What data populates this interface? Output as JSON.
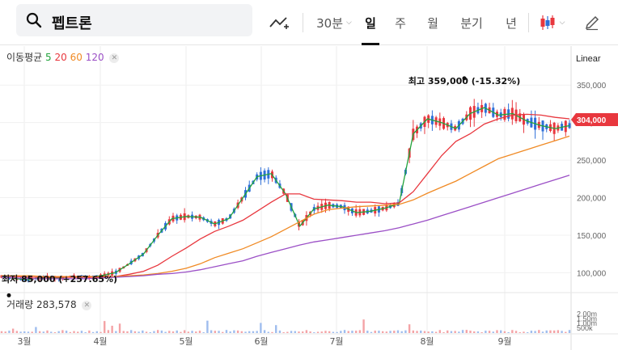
{
  "search": {
    "query": "펩트론"
  },
  "toolbar": {
    "interval": "30분",
    "tabs": [
      "일",
      "주",
      "월",
      "분기",
      "년"
    ],
    "active_tab": "일"
  },
  "indicators": {
    "label": "이동평균",
    "periods": [
      "5",
      "20",
      "60",
      "120"
    ],
    "colors": {
      "ma5": "#22a33b",
      "ma20": "#e8373e",
      "ma60": "#f08a24",
      "ma120": "#9b4fc6"
    }
  },
  "volume_label": {
    "name": "거래량",
    "value": "283,578"
  },
  "scale_mode": "Linear",
  "colors": {
    "up": "#e8373e",
    "down": "#2e6fd8",
    "price_tag": "#e8373e"
  },
  "chart_data": {
    "type": "candlestick",
    "x_months": [
      "3월",
      "4월",
      "5월",
      "6월",
      "7월",
      "8월",
      "9월"
    ],
    "y_ticks": [
      "350,000",
      "300,000",
      "250,000",
      "200,000",
      "150,000",
      "100,000"
    ],
    "y_tick_values": [
      350000,
      300000,
      250000,
      200000,
      150000,
      100000
    ],
    "y_range": [
      80000,
      375000
    ],
    "current_price": 304000,
    "current_price_label": "304,000",
    "high_annotation": {
      "text": "최고 359,000 (-15.32%)",
      "value": 359000
    },
    "low_annotation": {
      "text": "최저 85,000 (+257.65%)",
      "value": 85000
    },
    "volume_ticks": [
      "2.00m",
      "1.50m",
      "1.00m",
      "500k"
    ],
    "volume_tick_values": [
      2000000,
      1500000,
      1000000,
      500000
    ],
    "volume_max": 2200000,
    "ma_series": [
      {
        "name": "5",
        "color": "#22a33b",
        "values": [
          95000,
          92000,
          91000,
          94000,
          93000,
          95000,
          94000,
          96000,
          100000,
          112000,
          125000,
          150000,
          172000,
          175000,
          174000,
          165000,
          172000,
          200000,
          228000,
          232000,
          205000,
          162000,
          185000,
          190000,
          188000,
          180000,
          182000,
          186000,
          192000,
          285000,
          305000,
          300000,
          292000,
          312000,
          320000,
          310000,
          312000,
          302000,
          296000,
          292000,
          296000
        ]
      },
      {
        "name": "20",
        "color": "#e8373e",
        "values": [
          96000,
          95000,
          94000,
          94000,
          94000,
          94000,
          94000,
          94000,
          95000,
          98000,
          102000,
          110000,
          122000,
          133000,
          145000,
          155000,
          162000,
          170000,
          182000,
          194000,
          205000,
          205000,
          198000,
          197000,
          196000,
          194000,
          194000,
          192000,
          193000,
          208000,
          232000,
          256000,
          275000,
          285000,
          298000,
          305000,
          310000,
          311000,
          310000,
          307000,
          305000
        ]
      },
      {
        "name": "60",
        "color": "#f08a24",
        "values": [
          96000,
          96000,
          96000,
          95000,
          95000,
          95000,
          95000,
          95000,
          95000,
          96000,
          97000,
          99000,
          102000,
          106000,
          112000,
          120000,
          126000,
          132000,
          140000,
          148000,
          158000,
          168000,
          178000,
          184000,
          186000,
          188000,
          189000,
          190000,
          191000,
          197000,
          206000,
          214000,
          222000,
          232000,
          242000,
          252000,
          258000,
          264000,
          270000,
          276000,
          282000
        ]
      },
      {
        "name": "120",
        "color": "#9b4fc6",
        "values": [
          94000,
          93000,
          92000,
          92000,
          92000,
          92000,
          92000,
          93000,
          94000,
          95000,
          96000,
          98000,
          99000,
          101000,
          104000,
          108000,
          112000,
          116000,
          122000,
          127000,
          132000,
          137000,
          141000,
          144000,
          147000,
          150000,
          153000,
          156000,
          160000,
          165000,
          170000,
          176000,
          182000,
          188000,
          194000,
          200000,
          206000,
          212000,
          218000,
          224000,
          230000
        ]
      }
    ]
  }
}
